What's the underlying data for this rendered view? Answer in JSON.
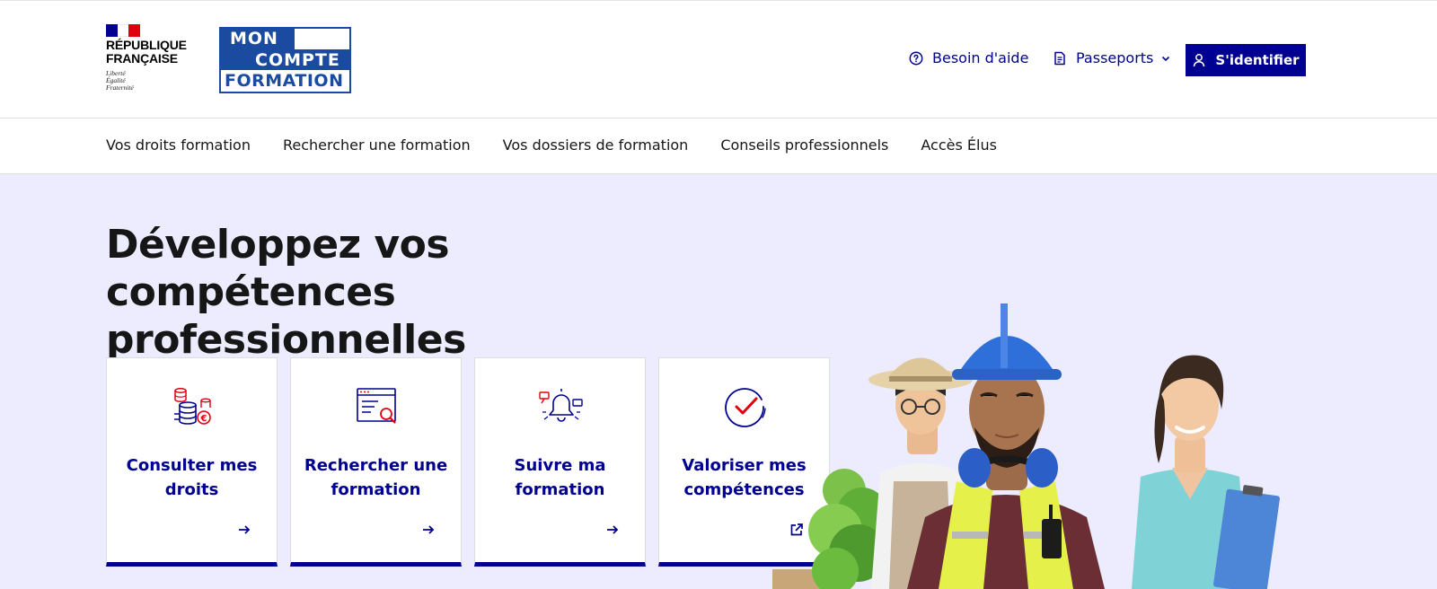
{
  "header": {
    "republique": {
      "line1": "RÉPUBLIQUE",
      "line2": "FRANÇAISE",
      "motto": [
        "Liberté",
        "Égalité",
        "Fraternité"
      ]
    },
    "logo": {
      "line1": "MON",
      "line2": "COMPTE",
      "line3": "FORMATION"
    },
    "help_label": "Besoin d'aide",
    "passports_label": "Passeports",
    "login_label": "S'identifier"
  },
  "nav": {
    "items": [
      "Vos droits formation",
      "Rechercher une formation",
      "Vos dossiers de formation",
      "Conseils professionnels",
      "Accès Élus"
    ]
  },
  "hero": {
    "title_line1": "Développez vos",
    "title_line2": "compétences professionnelles"
  },
  "cards": [
    {
      "label_l1": "Consulter mes",
      "label_l2": "droits",
      "icon": "coins-euro-icon",
      "link": "arrow-right-icon"
    },
    {
      "label_l1": "Rechercher une",
      "label_l2": "formation",
      "icon": "search-document-icon",
      "link": "arrow-right-icon"
    },
    {
      "label_l1": "Suivre ma",
      "label_l2": "formation",
      "icon": "bell-notification-icon",
      "link": "arrow-right-icon"
    },
    {
      "label_l1": "Valoriser mes",
      "label_l2": "compétences",
      "icon": "checkmark-circle-icon",
      "link": "external-link-icon"
    }
  ],
  "colors": {
    "primary": "#000091",
    "hero_bg": "#ececfe",
    "accent_red": "#e1000f",
    "logo_blue": "#1a4ba0"
  }
}
